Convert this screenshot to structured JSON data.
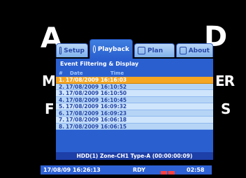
{
  "background": {
    "words": [
      "A",
      "D",
      "ME",
      "ER",
      "F",
      "S"
    ]
  },
  "tabs": [
    {
      "label": "Setup",
      "icon": "wrench-icon",
      "active": false
    },
    {
      "label": "Playback",
      "icon": "search-icon",
      "active": true
    },
    {
      "label": "Plan",
      "icon": "calendar-icon",
      "active": false
    },
    {
      "label": "About",
      "icon": "info-icon",
      "active": false
    }
  ],
  "section_title": "Event Filtering & Display",
  "columns": {
    "num": "#",
    "date": "Date",
    "time": "Time"
  },
  "events": [
    {
      "num": "1.",
      "datetime": "17/08/2009 16:16:03",
      "selected": true
    },
    {
      "num": "2.",
      "datetime": "17/08/2009 16:10:52",
      "selected": false
    },
    {
      "num": "3.",
      "datetime": "17/08/2009 16:10:50",
      "selected": false
    },
    {
      "num": "4.",
      "datetime": "17/08/2009 16:10:45",
      "selected": false
    },
    {
      "num": "5.",
      "datetime": "17/08/2009 16:09:32",
      "selected": false
    },
    {
      "num": "6.",
      "datetime": "17/08/2009 16:09:23",
      "selected": false
    },
    {
      "num": "7.",
      "datetime": "17/08/2009 16:06:18",
      "selected": false
    },
    {
      "num": "8.",
      "datetime": "17/08/2009 16:06:15",
      "selected": false
    }
  ],
  "hdd_info": "HDD(1) Zone-CH1 Type-A (00:00:00:09)",
  "status": {
    "datetime": "17/08/09 16:26:13",
    "state": "RDY",
    "clock": "02:58"
  },
  "colors": {
    "panel_blue": "#2a5fcf",
    "selected_row": "#f5a623",
    "row_light": "#cfe5fb",
    "row_dark": "#b6d5f6"
  }
}
